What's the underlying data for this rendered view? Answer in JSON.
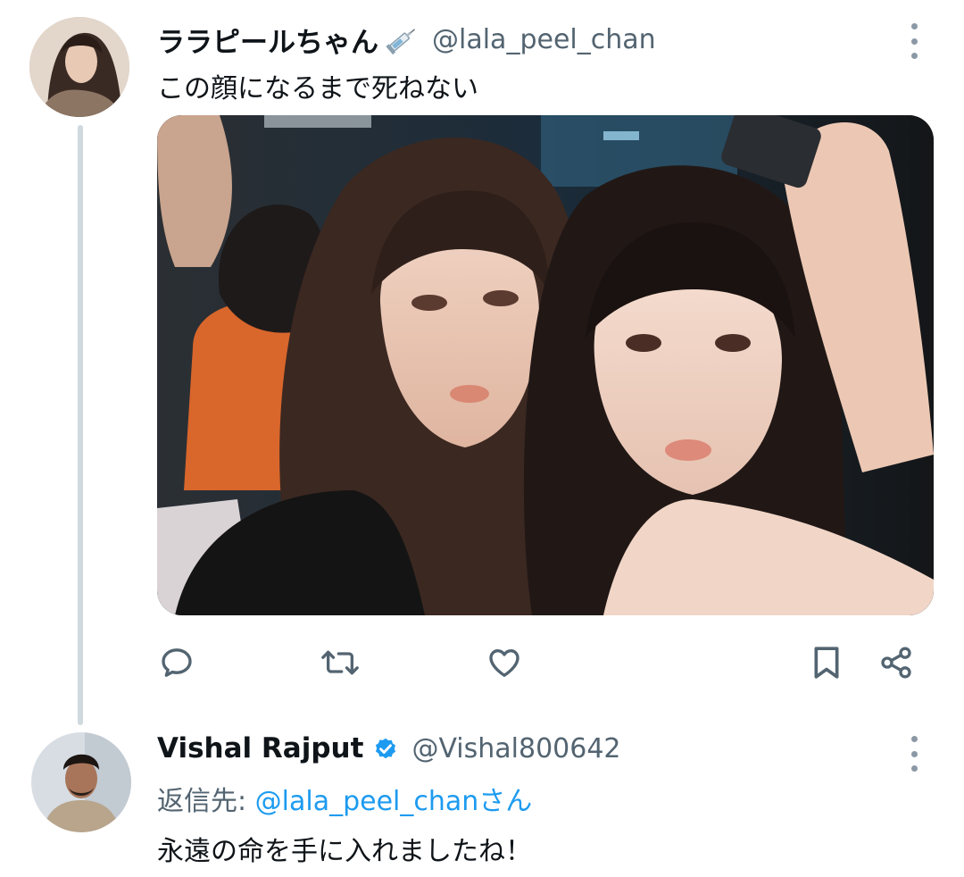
{
  "tweet": {
    "display_name": "ララピールちゃん",
    "handle": "@lala_peel_chan",
    "text": "この顔になるまで死ねない",
    "name_emoji_icon": "syringe-icon",
    "media_icon": "photo-two-women"
  },
  "actions": [
    "reply-icon",
    "retweet-icon",
    "like-icon",
    "bookmark-icon",
    "share-icon"
  ],
  "reply": {
    "display_name": "Vishal Rajput",
    "handle": "@Vishal800642",
    "verified": true,
    "reply_to_prefix": "返信先: ",
    "reply_to_mention": "@lala_peel_chanさん",
    "text": "永遠の命を手に入れましたね！"
  },
  "colors": {
    "accent": "#1d9bf0",
    "secondary_text": "#536471",
    "icon": "#536471",
    "thread_line": "#cfd9de"
  }
}
